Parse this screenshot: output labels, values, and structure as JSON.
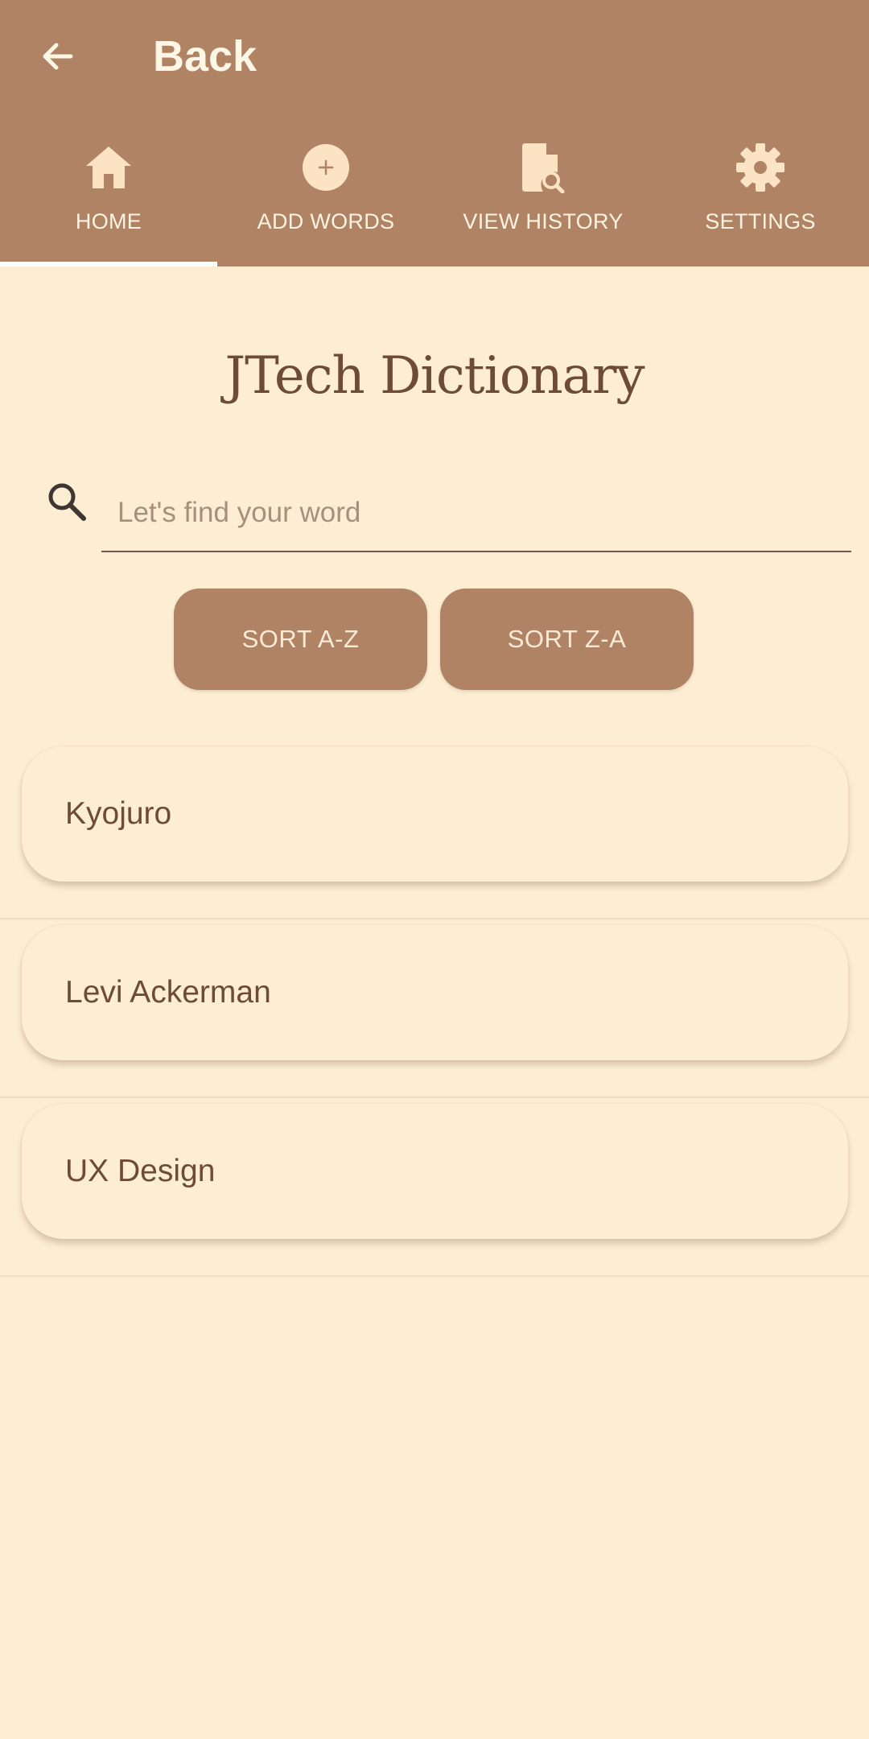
{
  "toolbar": {
    "title": "Back",
    "back_icon": "arrow-left-icon"
  },
  "tabs": [
    {
      "label": "HOME",
      "icon": "home-icon",
      "selected": true
    },
    {
      "label": "ADD WORDS",
      "icon": "plus-circle-icon",
      "selected": false
    },
    {
      "label": "VIEW HISTORY",
      "icon": "document-search-icon",
      "selected": false
    },
    {
      "label": "SETTINGS",
      "icon": "gear-icon",
      "selected": false
    }
  ],
  "page": {
    "title": "JTech Dictionary"
  },
  "search": {
    "placeholder": "Let's find your word",
    "value": ""
  },
  "sort": {
    "az_label": "SORT A-Z",
    "za_label": "SORT Z-A"
  },
  "words": [
    {
      "text": "Kyojuro"
    },
    {
      "text": "Levi Ackerman"
    },
    {
      "text": "UX Design"
    }
  ],
  "colors": {
    "header": "#B08365",
    "background": "#FDEED3",
    "text_brown": "#6E4B36",
    "tab_indicator": "#FFFFFF"
  }
}
